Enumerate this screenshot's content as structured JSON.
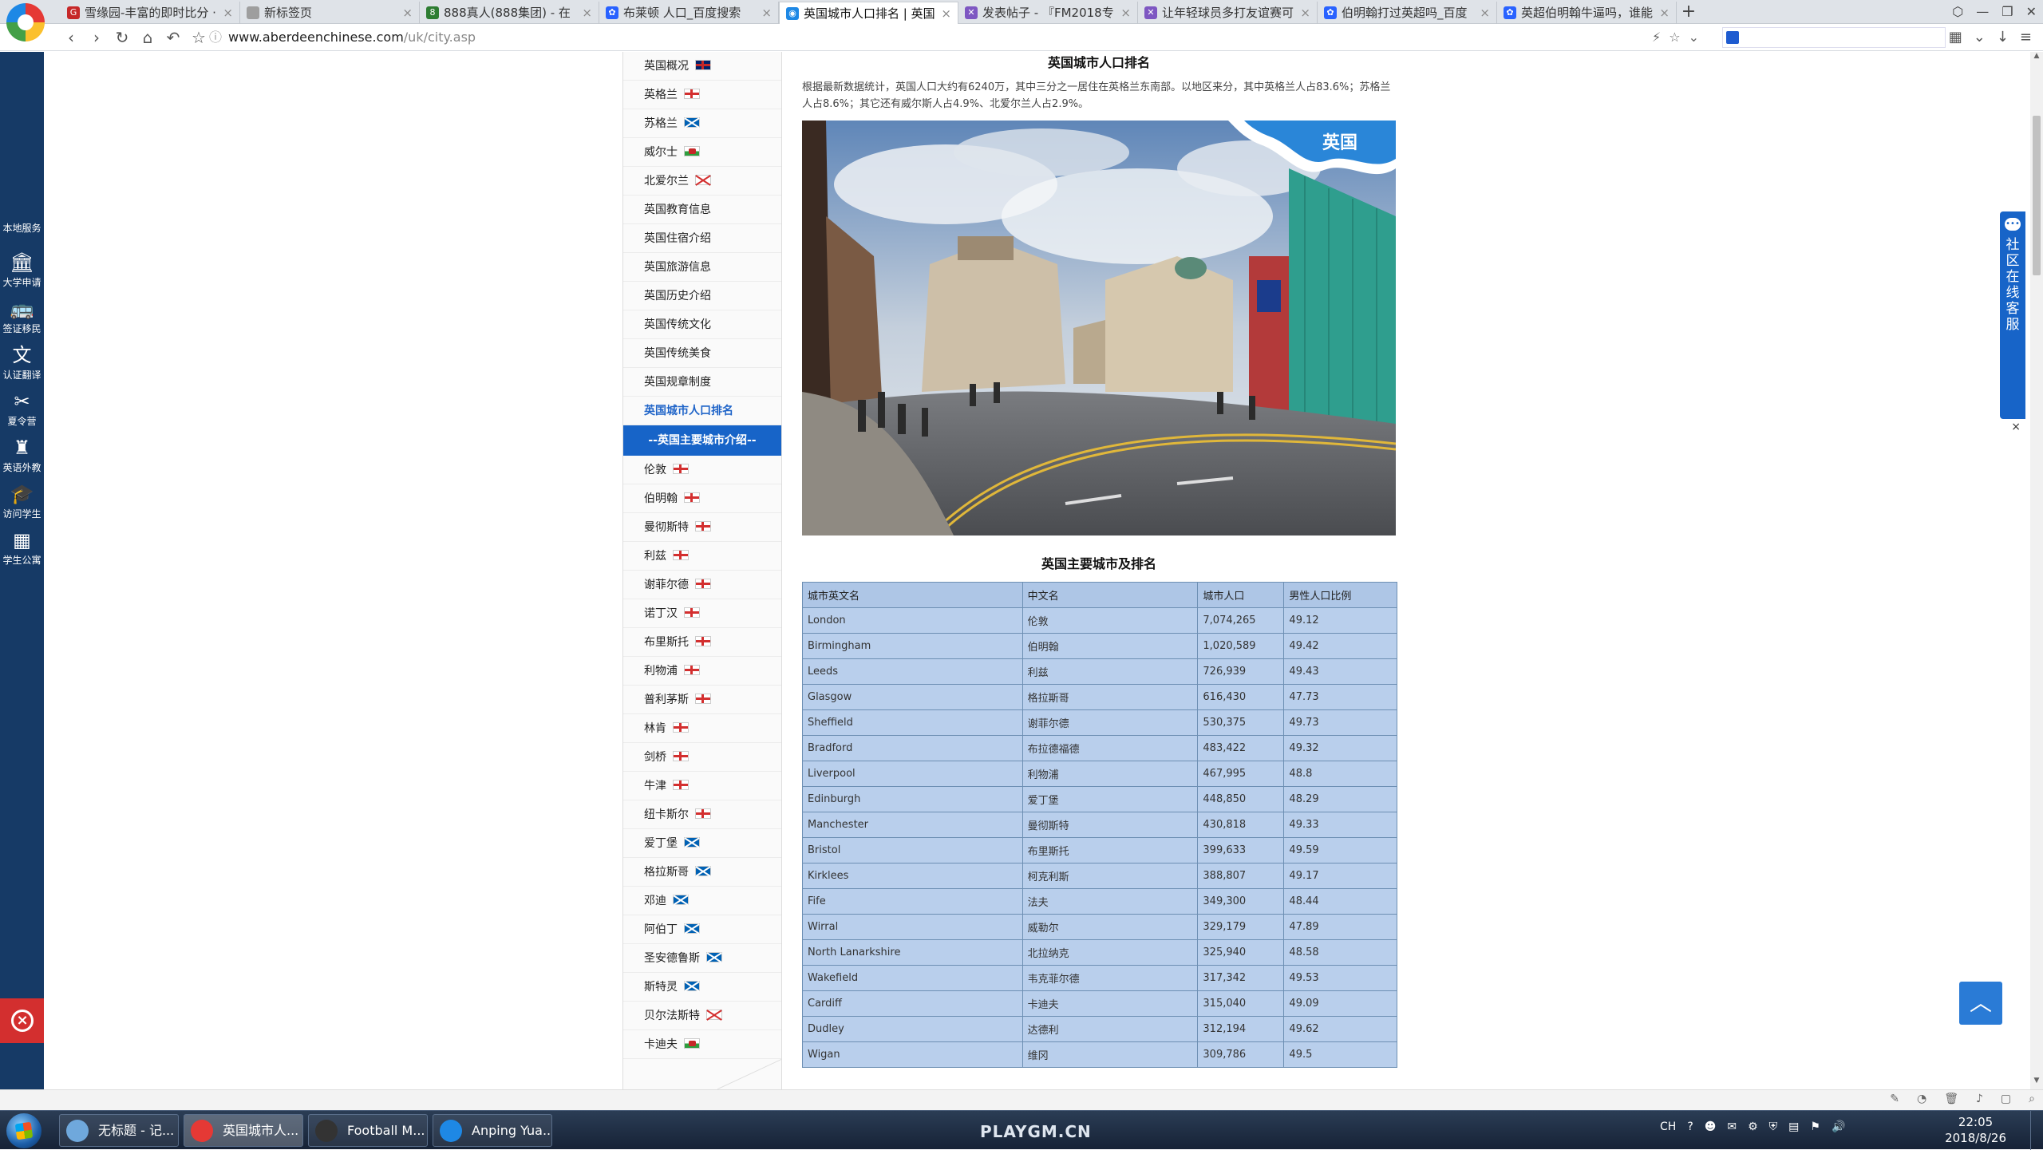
{
  "browser": {
    "tabs": [
      {
        "label": "雪缘园-丰富的即时比分 ·",
        "fav_color": "#c62828",
        "fav_glyph": "G"
      },
      {
        "label": "新标签页",
        "fav_color": "#9e9e9e",
        "fav_glyph": ""
      },
      {
        "label": "888真人(888集团) - 在",
        "fav_color": "#2e7d32",
        "fav_glyph": "8"
      },
      {
        "label": "布莱顿 人口_百度搜索",
        "fav_color": "#2962ff",
        "fav_glyph": "✿"
      },
      {
        "label": "英国城市人口排名 | 英国",
        "fav_color": "#1e88e5",
        "fav_glyph": "◉"
      },
      {
        "label": "发表帖子 - 『FM2018专",
        "fav_color": "#7e57c2",
        "fav_glyph": "✕"
      },
      {
        "label": "让年轻球员多打友谊赛可",
        "fav_color": "#7e57c2",
        "fav_glyph": "✕"
      },
      {
        "label": "伯明翰打过英超吗_百度",
        "fav_color": "#2962ff",
        "fav_glyph": "✿"
      },
      {
        "label": "英超伯明翰牛逼吗，谁能",
        "fav_color": "#2962ff",
        "fav_glyph": "✿"
      }
    ],
    "active_tab_index": 4,
    "url_host": "www.aberdeenchinese.com",
    "url_path": "/uk/city.asp"
  },
  "left_rail": {
    "items": [
      {
        "label": "本地服务",
        "icon": ""
      },
      {
        "label": "大学申请",
        "icon": "🏛"
      },
      {
        "label": "签证移民",
        "icon": "🚌"
      },
      {
        "label": "认证翻译",
        "icon": "文"
      },
      {
        "label": "夏令营",
        "icon": "✂"
      },
      {
        "label": "英语外教",
        "icon": "♜"
      },
      {
        "label": "访问学生",
        "icon": "🎓"
      },
      {
        "label": "学生公寓",
        "icon": "▦"
      }
    ]
  },
  "sidebar": {
    "items_top": [
      {
        "label": "英国概况",
        "flag": "uk"
      },
      {
        "label": "英格兰",
        "flag": "eng"
      },
      {
        "label": "苏格兰",
        "flag": "sco"
      },
      {
        "label": "威尔士",
        "flag": "wal"
      },
      {
        "label": "北爱尔兰",
        "flag": "nir"
      },
      {
        "label": "英国教育信息",
        "flag": ""
      },
      {
        "label": "英国住宿介绍",
        "flag": ""
      },
      {
        "label": "英国旅游信息",
        "flag": ""
      },
      {
        "label": "英国历史介绍",
        "flag": ""
      },
      {
        "label": "英国传统文化",
        "flag": ""
      },
      {
        "label": "英国传统美食",
        "flag": ""
      },
      {
        "label": "英国规章制度",
        "flag": ""
      },
      {
        "label": "英国城市人口排名",
        "flag": "",
        "active": true
      }
    ],
    "section_header": "--英国主要城市介绍--",
    "cities": [
      {
        "label": "伦敦",
        "flag": "eng"
      },
      {
        "label": "伯明翰",
        "flag": "eng"
      },
      {
        "label": "曼彻斯特",
        "flag": "eng"
      },
      {
        "label": "利兹",
        "flag": "eng"
      },
      {
        "label": "谢菲尔德",
        "flag": "eng"
      },
      {
        "label": "诺丁汉",
        "flag": "eng"
      },
      {
        "label": "布里斯托",
        "flag": "eng"
      },
      {
        "label": "利物浦",
        "flag": "eng"
      },
      {
        "label": "普利茅斯",
        "flag": "eng"
      },
      {
        "label": "林肯",
        "flag": "eng"
      },
      {
        "label": "剑桥",
        "flag": "eng"
      },
      {
        "label": "牛津",
        "flag": "eng"
      },
      {
        "label": "纽卡斯尔",
        "flag": "eng"
      },
      {
        "label": "爱丁堡",
        "flag": "sco"
      },
      {
        "label": "格拉斯哥",
        "flag": "sco"
      },
      {
        "label": "邓迪",
        "flag": "sco"
      },
      {
        "label": "阿伯丁",
        "flag": "sco"
      },
      {
        "label": "圣安德鲁斯",
        "flag": "sco"
      },
      {
        "label": "斯特灵",
        "flag": "sco"
      },
      {
        "label": "贝尔法斯特",
        "flag": "nir"
      },
      {
        "label": "卡迪夫",
        "flag": "wal"
      }
    ]
  },
  "content": {
    "title": "英国城市人口排名",
    "intro": "根据最新数据统计，英国人口大约有6240万，其中三分之一居住在英格兰东南部。以地区来分，其中英格兰人占83.6%；苏格兰人占8.6%；其它还有威尔斯人占4.9%、北爱尔兰人占2.9%。",
    "hero_badge": "英国",
    "table_title": "英国主要城市及排名",
    "columns": [
      "城市英文名",
      "中文名",
      "城市人口",
      "男性人口比例"
    ],
    "rows": [
      [
        "London",
        "伦敦",
        "7,074,265",
        "49.12"
      ],
      [
        "Birmingham",
        "伯明翰",
        "1,020,589",
        "49.42"
      ],
      [
        "Leeds",
        "利兹",
        "726,939",
        "49.43"
      ],
      [
        "Glasgow",
        "格拉斯哥",
        "616,430",
        "47.73"
      ],
      [
        "Sheffield",
        "谢菲尔德",
        "530,375",
        "49.73"
      ],
      [
        "Bradford",
        "布拉德福德",
        "483,422",
        "49.32"
      ],
      [
        "Liverpool",
        "利物浦",
        "467,995",
        "48.8"
      ],
      [
        "Edinburgh",
        "爱丁堡",
        "448,850",
        "48.29"
      ],
      [
        "Manchester",
        "曼彻斯特",
        "430,818",
        "49.33"
      ],
      [
        "Bristol",
        "布里斯托",
        "399,633",
        "49.59"
      ],
      [
        "Kirklees",
        "柯克利斯",
        "388,807",
        "49.17"
      ],
      [
        "Fife",
        "法夫",
        "349,300",
        "48.44"
      ],
      [
        "Wirral",
        "威勒尔",
        "329,179",
        "47.89"
      ],
      [
        "North Lanarkshire",
        "北拉纳克",
        "325,940",
        "48.58"
      ],
      [
        "Wakefield",
        "韦克菲尔德",
        "317,342",
        "49.53"
      ],
      [
        "Cardiff",
        "卡迪夫",
        "315,040",
        "49.09"
      ],
      [
        "Dudley",
        "达德利",
        "312,194",
        "49.62"
      ],
      [
        "Wigan",
        "维冈",
        "309,786",
        "49.5"
      ]
    ]
  },
  "service_widget": {
    "text": "社区在线客服",
    "close": "×"
  },
  "to_top_glyph": "︿",
  "taskbar": {
    "buttons": [
      {
        "label": "无标题 - 记...",
        "icon_color": "#6fa8dc"
      },
      {
        "label": "英国城市人...",
        "icon_color": "#e53935"
      },
      {
        "label": "Football M...",
        "icon_color": "#333333"
      },
      {
        "label": "Anping Yua...",
        "icon_color": "#1e88e5"
      }
    ],
    "active_index": 1,
    "watermark": "PLAYGM.CN",
    "tray_lang": "CH",
    "time": "22:05",
    "date": "2018/8/26"
  }
}
